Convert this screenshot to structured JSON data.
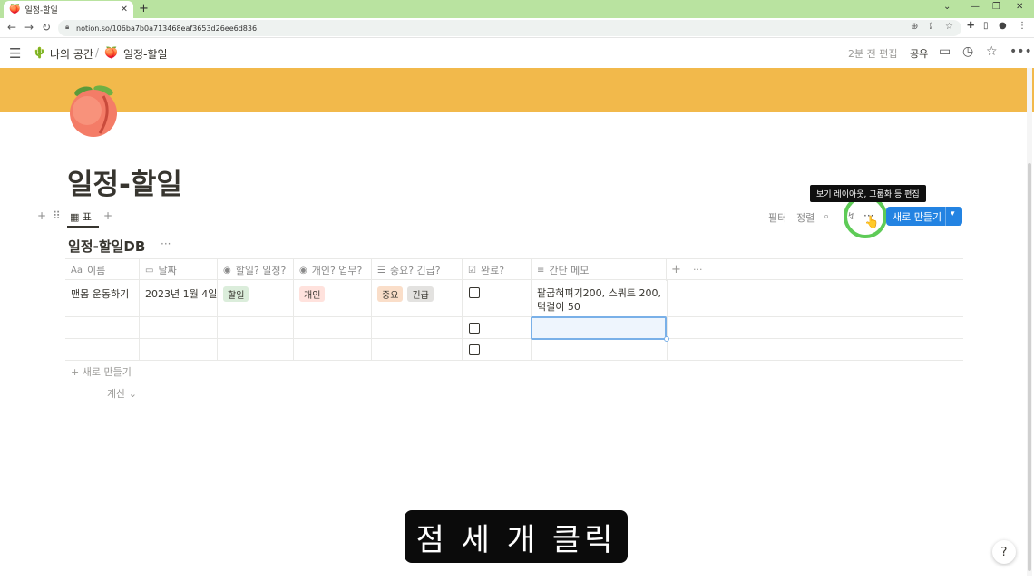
{
  "browser": {
    "tab_title": "일정-할일",
    "tab_favicon": "🍑",
    "url": "notion.so/106ba7b0a713468eaf3653d26ee6d836",
    "new_tab": "+",
    "close_tab": "✕",
    "window_controls": [
      "⌄",
      "—",
      "❐",
      "✕"
    ]
  },
  "topbar": {
    "workspace_icon": "🌵",
    "workspace": "나의 공간",
    "separator": "/",
    "page_icon": "🍑",
    "page": "일정-할일",
    "edited": "2분 전 편집",
    "share": "공유"
  },
  "page": {
    "title": "일정-할일",
    "cover_color": "#f2b94b"
  },
  "view": {
    "tab_icon": "▦",
    "tab_label": "표",
    "add_view": "+",
    "filter": "필터",
    "sort": "정렬",
    "new_label": "새로 만들기",
    "tooltip": "보기 레이아웃, 그룹화 등 편집",
    "more": "···"
  },
  "database": {
    "title": "일정-할일DB",
    "more": "···",
    "columns": [
      {
        "icon": "Aa",
        "label": "이름"
      },
      {
        "icon": "▭",
        "label": "날짜"
      },
      {
        "icon": "◉",
        "label": "할일? 일정?"
      },
      {
        "icon": "◉",
        "label": "개인? 업무?"
      },
      {
        "icon": "☰",
        "label": "중요? 긴급?"
      },
      {
        "icon": "☑",
        "label": "완료?"
      },
      {
        "icon": "≡",
        "label": "간단 메모"
      }
    ],
    "add_column": "+",
    "column_more": "···",
    "rows": [
      {
        "name": "맨몸 운동하기",
        "date": "2023년 1월 4일",
        "type": "할일",
        "type_color": "#dbeddb",
        "scope": "개인",
        "scope_color": "#ffe2dd",
        "priority": [
          "중요",
          "긴급"
        ],
        "priority_colors": [
          "#fadec9",
          "#e3e2e0"
        ],
        "memo": "팔굽혀펴기200, 스쿼트 200, 턱걸이 50"
      },
      {
        "name": "",
        "date": "",
        "memo": ""
      },
      {
        "name": "",
        "date": "",
        "memo": ""
      }
    ],
    "new_row": "새로 만들기",
    "calc": "계산"
  },
  "caption": "점 세 개 클릭",
  "help": "?"
}
